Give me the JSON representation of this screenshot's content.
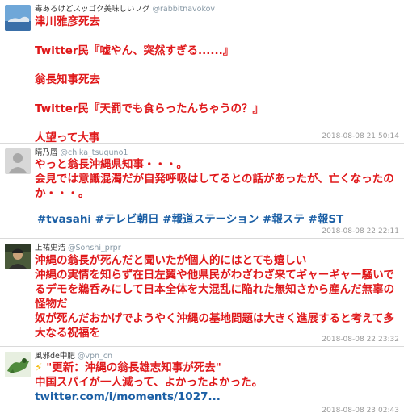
{
  "tweets": [
    {
      "display_name": "毒あるけどスッゴク美味しいフグ",
      "handle": "@rabbitnavokov",
      "lines": [
        "津川雅彦死去",
        "",
        "Twitter民『嘘やん、突然すぎる......』",
        "",
        "翁長知事死去",
        "",
        "Twitter民『天罰でも食らったんちゃうの？』",
        "",
        "人望って大事"
      ],
      "timestamp": "2018-08-08 21:50:14"
    },
    {
      "display_name": "睛乃唇",
      "handle": "@chika_tsuguno1",
      "lines": [
        "やっと翁長沖縄県知事・・・。",
        "会見では意識混濁だが自発呼吸はしてるとの話があったが、亡くなったのか・・・。"
      ],
      "hashtags": "#tvasahi #テレビ朝日 #報道ステーション #報ステ #報ST",
      "timestamp": "2018-08-08 22:22:11"
    },
    {
      "display_name": "上祐史浩",
      "handle": "@Sonshi_prpr",
      "lines": [
        "沖縄の翁長が死んだと聞いたが個人的にはとても嬉しい",
        "沖縄の実情を知らず在日左翼や他県民がわざわざ来てギャーギャー騒いでるデモを鵜呑みにして日本全体を大混乱に陥れた無知さから産んだ無辜の怪物だ",
        "奴が死んだおかげでようやく沖縄の基地問題は大きく進展すると考えて多大なる祝福を"
      ],
      "timestamp": "2018-08-08 22:23:32"
    },
    {
      "display_name": "風邪de中肥",
      "handle": "@vpn_cn",
      "quote_line": "\"更新：沖縄の翁長雄志知事が死去\"",
      "lines": [
        "中国スパイが一人減って、よかったよかった。"
      ],
      "link": "twitter.com/i/moments/1027...",
      "timestamp": "2018-08-08 23:02:43"
    }
  ],
  "icons": {
    "lightning": "lightning-icon"
  }
}
